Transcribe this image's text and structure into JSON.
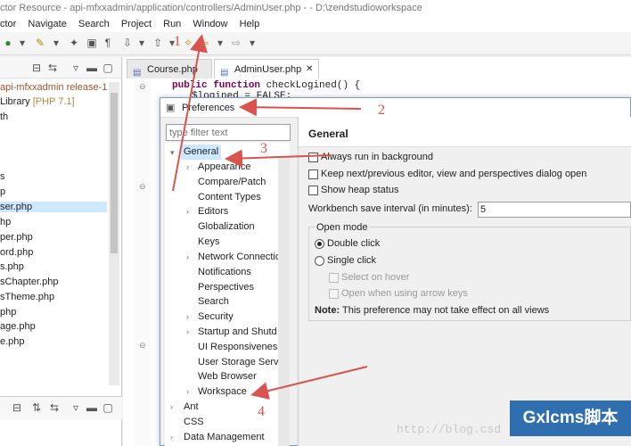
{
  "window": {
    "title": "ctor Resource - api-mfxxadmin/application/controllers/AdminUser.php -  - D:\\zendstudioworkspace"
  },
  "menu": [
    "Navigate",
    "Search",
    "Project",
    "Run",
    "Window",
    "Help"
  ],
  "menu_partial": "ctor",
  "left_panel": {
    "project": "api-mfxxadmin release-1",
    "library": "Library [PHP 7.1]",
    "lib_version": "[PHP 7.1]",
    "path": "th",
    "files": [
      "s",
      "p",
      "ser.php",
      "hp",
      "per.php",
      "ord.php",
      "s.php",
      "sChapter.php",
      "sTheme.php",
      "php",
      "age.php",
      "e.php"
    ]
  },
  "editor": {
    "tabs": [
      {
        "label": "Course.php",
        "active": false
      },
      {
        "label": "AdminUser.php",
        "active": true
      }
    ],
    "code_line1_kw": "public function",
    "code_line1_rest": "checkLogined() {",
    "code_line2": "$logined = FALSE;"
  },
  "dialog": {
    "title": "Preferences",
    "filter_placeholder": "type filter text",
    "tree": [
      {
        "label": "General",
        "expanded": true,
        "level": 0,
        "selected": true
      },
      {
        "label": "Appearance",
        "level": 1,
        "has_children": true
      },
      {
        "label": "Compare/Patch",
        "level": 1
      },
      {
        "label": "Content Types",
        "level": 1
      },
      {
        "label": "Editors",
        "level": 1,
        "has_children": true
      },
      {
        "label": "Globalization",
        "level": 1
      },
      {
        "label": "Keys",
        "level": 1
      },
      {
        "label": "Network Connectio",
        "level": 1,
        "has_children": true
      },
      {
        "label": "Notifications",
        "level": 1
      },
      {
        "label": "Perspectives",
        "level": 1
      },
      {
        "label": "Search",
        "level": 1
      },
      {
        "label": "Security",
        "level": 1,
        "has_children": true
      },
      {
        "label": "Startup and Shutd",
        "level": 1,
        "has_children": true
      },
      {
        "label": "UI Responsiveness",
        "level": 1
      },
      {
        "label": "User Storage Serv",
        "level": 1
      },
      {
        "label": "Web Browser",
        "level": 1
      },
      {
        "label": "Workspace",
        "level": 1,
        "has_children": true
      },
      {
        "label": "Ant",
        "level": 0,
        "has_children": true
      },
      {
        "label": "CSS",
        "level": 0
      },
      {
        "label": "Data Management",
        "level": 0,
        "has_children": true
      }
    ],
    "page_title": "General",
    "options": {
      "run_background": {
        "label": "Always run in background",
        "checked": false
      },
      "keep_next_prev": {
        "label": "Keep next/previous editor, view and perspectives dialog open",
        "checked": false
      },
      "show_heap": {
        "label": "Show heap status",
        "checked": false
      }
    },
    "save_interval": {
      "label": "Workbench save interval (in minutes):",
      "value": "5"
    },
    "open_mode": {
      "legend": "Open mode",
      "double_click": "Double click",
      "single_click": "Single click",
      "select_hover": "Select on hover",
      "open_arrow": "Open when using arrow keys",
      "selected": "double_click"
    },
    "note_label": "Note:",
    "note_text": "This preference may not take effect on all views"
  },
  "annotations": {
    "a1": "1",
    "a2": "2",
    "a3": "3",
    "a4": "4",
    "color": "#d9534f"
  },
  "watermark": {
    "brand": "Gxlcms脚本",
    "url": "http://blog.csd"
  }
}
